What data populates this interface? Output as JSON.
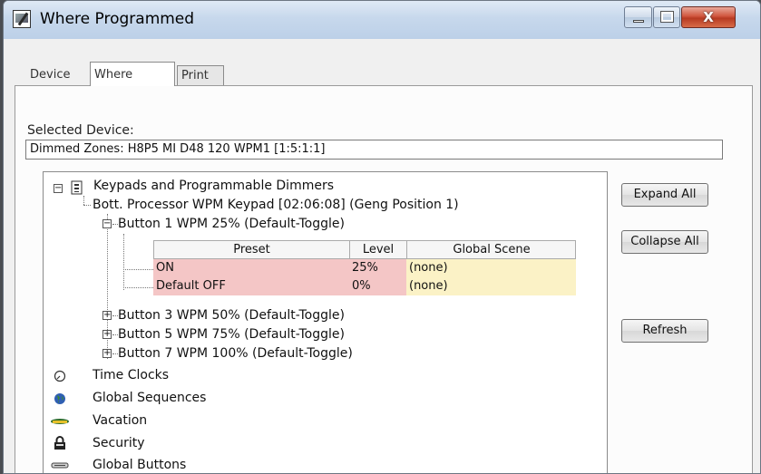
{
  "window": {
    "title": "Where Programmed",
    "close_glyph": "X"
  },
  "tabs": [
    {
      "label": "Device",
      "active": false
    },
    {
      "label": "Where",
      "active": true
    },
    {
      "label": "Print",
      "active": false
    }
  ],
  "selected_device": {
    "label": "Selected Device:",
    "value": "Dimmed Zones: H8P5 MI D48 120 WPM1 [1:5:1:1]"
  },
  "tree": {
    "root": {
      "label": "Keypads and Programmable Dimmers",
      "expander": "−",
      "icon": "keypad-icon"
    },
    "keypad": {
      "label": "Bott. Processor WPM Keypad [02:06:08] (Geng Position 1)"
    },
    "button1": {
      "label": "Button 1  WPM 25% (Default-Toggle)",
      "expander": "−"
    },
    "grid": {
      "columns": [
        "Preset",
        "Level",
        "Global Scene"
      ],
      "rows": [
        {
          "preset": "ON",
          "level": "25%",
          "scene": "(none)"
        },
        {
          "preset": "Default OFF",
          "level": "0%",
          "scene": "(none)"
        }
      ],
      "colors": {
        "preset_level_bg": "#f4c6c6",
        "scene_bg": "#fbf2c6"
      }
    },
    "collapsed_buttons": [
      {
        "label": "Button 3  WPM 50% (Default-Toggle)",
        "expander": "+"
      },
      {
        "label": "Button 5  WPM 75% (Default-Toggle)",
        "expander": "+"
      },
      {
        "label": "Button 7  WPM 100% (Default-Toggle)",
        "expander": "+"
      }
    ],
    "categories": [
      {
        "label": "Time Clocks",
        "icon": "clock-icon"
      },
      {
        "label": "Global Sequences",
        "icon": "globe-icon"
      },
      {
        "label": "Vacation",
        "icon": "vacation-icon"
      },
      {
        "label": "Security",
        "icon": "lock-icon"
      },
      {
        "label": "Global Buttons",
        "icon": "button-icon"
      }
    ]
  },
  "buttons": {
    "expand_all": "Expand All",
    "collapse_all": "Collapse All",
    "refresh": "Refresh"
  }
}
